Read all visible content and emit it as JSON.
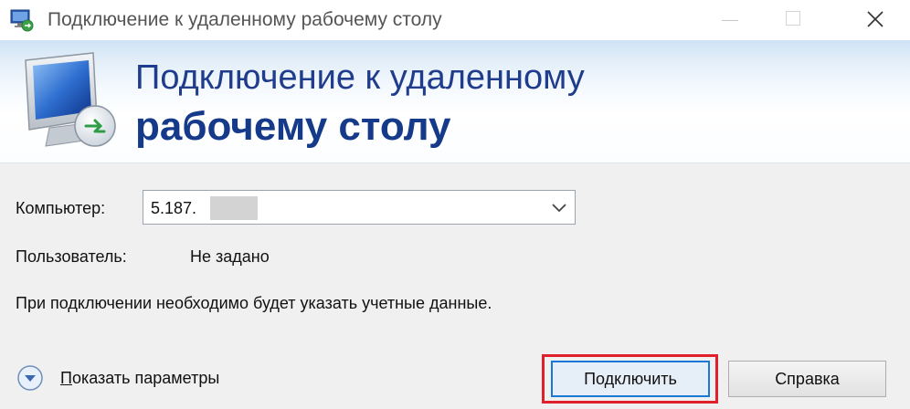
{
  "window": {
    "title": "Подключение к удаленному рабочему столу",
    "controls": [
      "minimize-icon",
      "maximize-icon",
      "close-icon"
    ]
  },
  "banner": {
    "line1": "Подключение к удаленному",
    "line2": "рабочему столу",
    "icon": "remote-desktop-monitor-icon"
  },
  "form": {
    "computer_label": "Компьютер:",
    "computer_value": "5.187.",
    "user_label": "Пользователь:",
    "user_value": "Не задано",
    "info_text": "При подключении необходимо будет указать учетные данные."
  },
  "footer": {
    "show_options_prefix": "П",
    "show_options_rest": "оказать параметры",
    "connect_label": "Подключить",
    "help_label": "Справка"
  },
  "colors": {
    "banner_text": "#1f3d8c",
    "highlight_border": "#e0202a",
    "default_button_border": "#1a79d8"
  }
}
